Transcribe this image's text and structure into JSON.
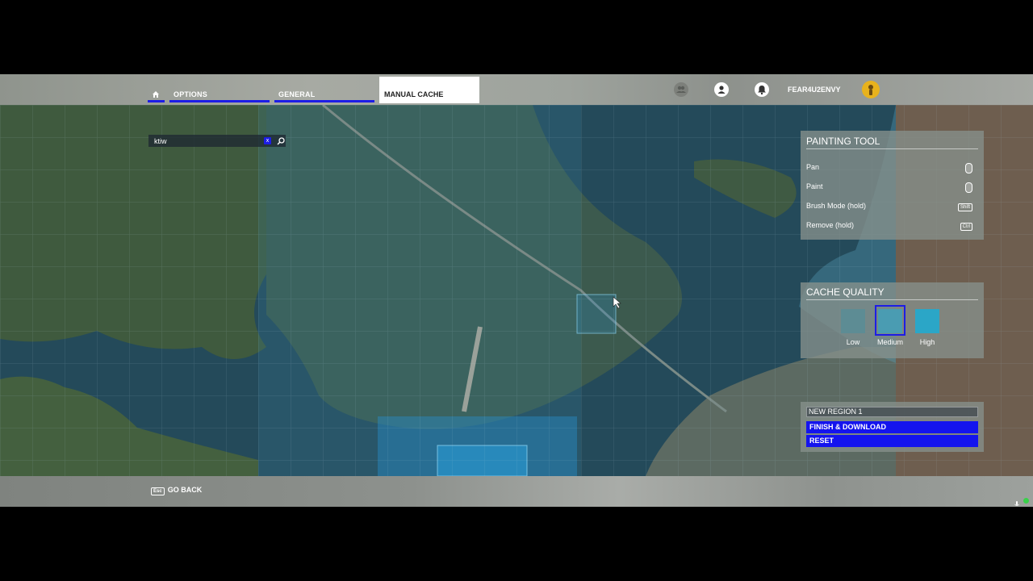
{
  "nav": {
    "home_icon": "home-icon",
    "options_label": "OPTIONS",
    "general_label": "GENERAL",
    "manual_cache_label": "MANUAL CACHE",
    "accent_color": "#1d1de6"
  },
  "account": {
    "friends_icon": "friends-icon",
    "profile_icon": "profile-icon",
    "notifications_icon": "bell-icon",
    "username": "FEAR4U2ENVY",
    "avatar_icon": "avatar-icon"
  },
  "search": {
    "value": "ktiw",
    "clear_label": "x",
    "search_icon": "search-icon"
  },
  "painting_tool": {
    "title": "PAINTING TOOL",
    "rows": [
      {
        "label": "Pan",
        "key_icon": "mouse-left-icon"
      },
      {
        "label": "Paint",
        "key_icon": "mouse-right-icon"
      },
      {
        "label": "Brush Mode (hold)",
        "key": "Shift"
      },
      {
        "label": "Remove (hold)",
        "key": "Ctrl"
      }
    ]
  },
  "cache_quality": {
    "title": "CACHE QUALITY",
    "options": [
      "Low",
      "Medium",
      "High"
    ],
    "selected": "Medium"
  },
  "region": {
    "name": "NEW REGION 1",
    "finish_label": "FINISH & DOWNLOAD",
    "reset_label": "RESET"
  },
  "footer": {
    "back_key": "Esc",
    "back_label": "GO BACK"
  }
}
